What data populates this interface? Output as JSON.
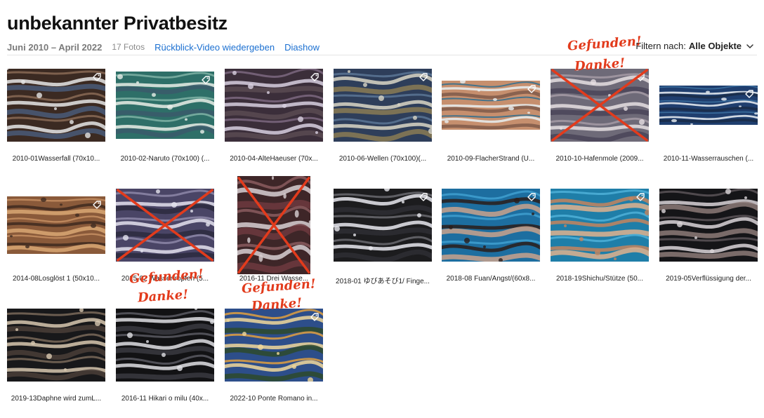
{
  "header": {
    "title": "unbekannter Privatbesitz",
    "date_range": "Juni 2010 – April 2022",
    "count": "17 Fotos",
    "memory_video": "Rückblick-Video wiedergeben",
    "slideshow": "Diashow",
    "filter_label": "Filtern nach:",
    "filter_value": "Alle Objekte"
  },
  "colors": {
    "accent": "#1a6fd1",
    "annotation": "#e23b1c"
  },
  "photos": [
    {
      "caption": "2010-01Wasserfall (70x10...",
      "palette": [
        "#3b2a22",
        "#8a6a55",
        "#e6e6e6",
        "#4a5a78"
      ],
      "tag": true,
      "crossed": false
    },
    {
      "caption": "2010-02-Naruto (70x100) (...",
      "palette": [
        "#2e6f68",
        "#7fb3a6",
        "#e9efe8",
        "#3a5b6b"
      ],
      "tag": true,
      "crossed": false
    },
    {
      "caption": "2010-04-AlteHaeuser (70x...",
      "palette": [
        "#3b2e3a",
        "#7d6780",
        "#d8cfe0",
        "#5a4a52"
      ],
      "tag": true,
      "crossed": false
    },
    {
      "caption": "2010-06-Wellen (70x100)(...",
      "palette": [
        "#2e3e5a",
        "#5b7595",
        "#d9d6c6",
        "#8a7b55"
      ],
      "tag": true,
      "crossed": false
    },
    {
      "caption": "2010-09-FlacherStrand (U...",
      "palette": [
        "#c68f6e",
        "#2f6f8f",
        "#e8f0f2",
        "#7f5a4a"
      ],
      "tag": true,
      "crossed": false
    },
    {
      "caption": "2010-10-Hafenmole (2009...",
      "palette": [
        "#6e6a78",
        "#a49aa5",
        "#e6dfe2",
        "#4a4458"
      ],
      "tag": true,
      "crossed": true
    },
    {
      "caption": "2010-11-Wasserrauschen (...",
      "palette": [
        "#1f3e6e",
        "#3f76a6",
        "#eef2f6",
        "#1a2b48"
      ],
      "tag": true,
      "crossed": false
    },
    {
      "caption": "2014-08Losglöst 1 (50x10...",
      "palette": [
        "#8a5a3a",
        "#c58f63",
        "#3e2a20",
        "#d9a874"
      ],
      "tag": true,
      "crossed": false
    },
    {
      "caption": "2015-02 Wassertropfen (5...",
      "palette": [
        "#4a4566",
        "#8d87a8",
        "#e4e2ee",
        "#2b2a3e"
      ],
      "tag": false,
      "crossed": true
    },
    {
      "caption": "2016-11 Drei Wasse...",
      "palette": [
        "#3e2628",
        "#8a5c5e",
        "#d8d0d2",
        "#6d3a3e"
      ],
      "tag": false,
      "crossed": true
    },
    {
      "caption": "2018-01 ゆびあそび1/  Finge...",
      "palette": [
        "#1c1c1e",
        "#6a6a70",
        "#e8e8ee",
        "#2e2e34"
      ],
      "tag": true,
      "crossed": false
    },
    {
      "caption": "2018-08 Fuan/Angst/(60x8...",
      "palette": [
        "#1d6ea0",
        "#3fa0d0",
        "#2a1d1a",
        "#c9a28c"
      ],
      "tag": true,
      "crossed": false
    },
    {
      "caption": "2018-19Shichu/Stütze (50...",
      "palette": [
        "#1f7ea8",
        "#4fb0d8",
        "#c4845e",
        "#e0b28e"
      ],
      "tag": true,
      "crossed": false
    },
    {
      "caption": "2019-05Verflüssigung der...",
      "palette": [
        "#151518",
        "#5a5458",
        "#d9d4d8",
        "#8c7a78"
      ],
      "tag": false,
      "crossed": false
    },
    {
      "caption": "2019-13Daphne wird zumL...",
      "palette": [
        "#18181a",
        "#7a6a5a",
        "#d8c8b0",
        "#4a3e38"
      ],
      "tag": false,
      "crossed": false
    },
    {
      "caption": "2016-11 Hikari o milu (40x...",
      "palette": [
        "#121214",
        "#5a5a62",
        "#e0e0e4",
        "#3a3a40"
      ],
      "tag": false,
      "crossed": false
    },
    {
      "caption": "2022-10 Ponte Romano in...",
      "palette": [
        "#2d4e8a",
        "#e0a040",
        "#f1d89a",
        "#2e4a2a"
      ],
      "tag": true,
      "crossed": false
    }
  ],
  "annotations": {
    "found": "Gefunden!",
    "thanks": "Danke!"
  }
}
